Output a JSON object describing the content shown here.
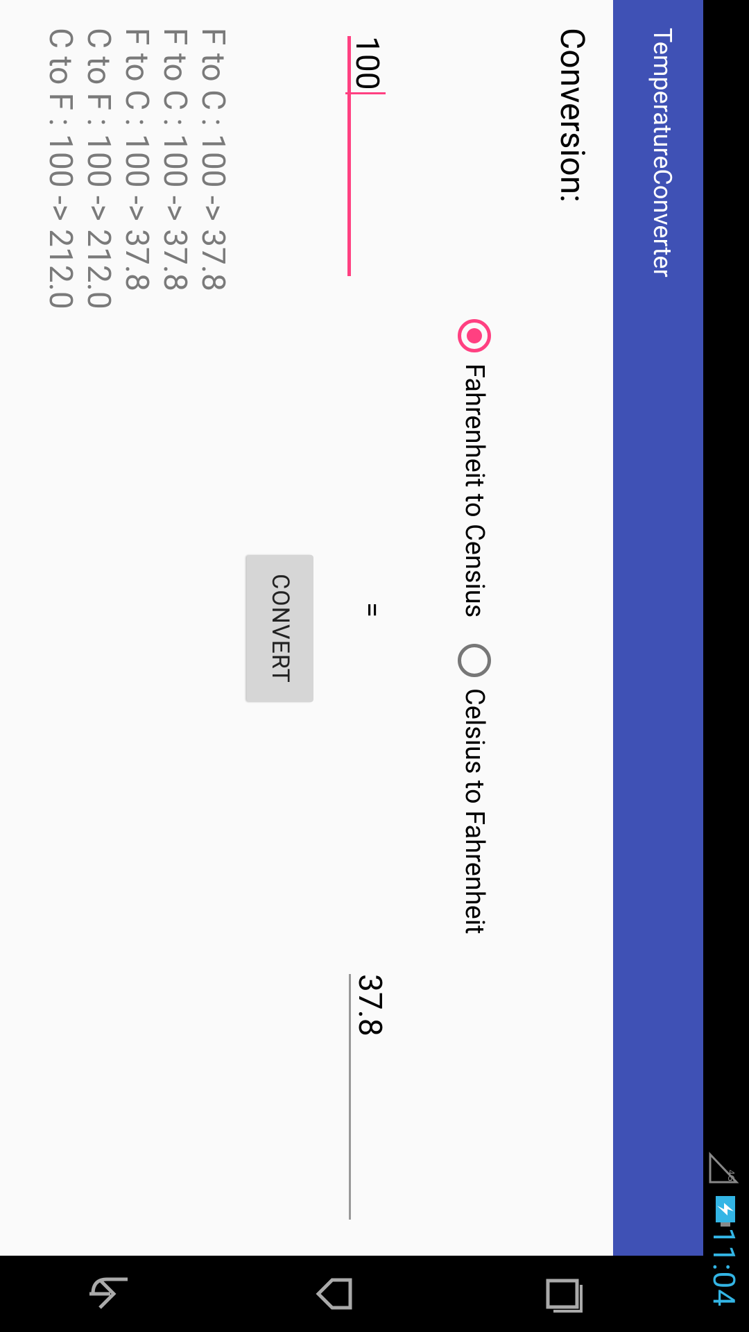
{
  "status_bar": {
    "time": "11:04",
    "network": "4G",
    "signal_icon": "signal-icon",
    "battery_icon": "battery-charging-icon"
  },
  "app": {
    "title": "TemperatureConverter"
  },
  "form": {
    "conversion_label": "Conversion:",
    "options": [
      {
        "label": "Fahrenheit to Censius",
        "checked": true
      },
      {
        "label": "Celsius to Fahrenheit",
        "checked": false
      }
    ],
    "input_value": "100",
    "equals": "=",
    "result": "37.8",
    "convert_button": "CONVERT"
  },
  "history": [
    "F to C : 100  ->  37.8",
    "F to C : 100  ->  37.8",
    "F to C : 100  ->  37.8",
    "C to F : 100  ->  212.0",
    "C to F : 100  ->  212.0"
  ],
  "colors": {
    "primary": "#3f51b5",
    "accent": "#ff4081",
    "status_time": "#33b5e5"
  },
  "nav": {
    "back_icon": "back-icon",
    "home_icon": "home-icon",
    "recents_icon": "recents-icon"
  }
}
